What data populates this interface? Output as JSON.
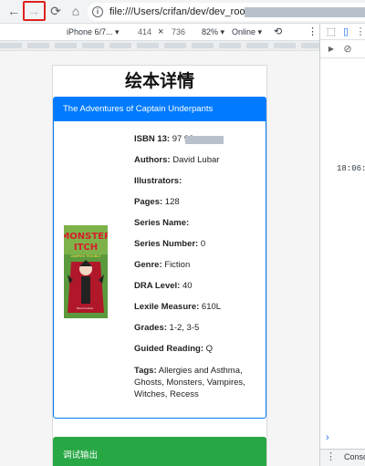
{
  "browser": {
    "back_icon": "←",
    "forward_icon": "→",
    "reload_icon": "⟳",
    "home_icon": "⌂",
    "info_icon": "i",
    "url": "file:///Users/crifan/dev/dev_root/"
  },
  "device_toolbar": {
    "device": "iPhone 6/7...",
    "width": "414",
    "times": "×",
    "height": "736",
    "zoom": "82%",
    "network": "Online",
    "rotate_icon": "⟲",
    "more_icon": "⋮"
  },
  "devtools": {
    "inspect_icon": "⬚",
    "device_icon": "▯",
    "more_icon": "⋮",
    "sidebar_icon": "▶",
    "clear_icon": "⊘",
    "timestamp": "18:06:0",
    "prompt": "›",
    "drawer_more_icon": "⋮",
    "drawer_tab": "Conso"
  },
  "page": {
    "title": "绘本详情",
    "book_title": "The Adventures of Captain Underpants",
    "fields": [
      {
        "label": "ISBN 13:",
        "value": " 97               99"
      },
      {
        "label": "Authors:",
        "value": " David Lubar"
      },
      {
        "label": "Illustrators:",
        "value": ""
      },
      {
        "label": "Pages:",
        "value": " 128"
      },
      {
        "label": "Series Name:",
        "value": ""
      },
      {
        "label": "Series Number:",
        "value": " 0"
      },
      {
        "label": "Genre:",
        "value": " Fiction"
      },
      {
        "label": "DRA Level:",
        "value": " 40"
      },
      {
        "label": "Lexile Measure:",
        "value": " 610L"
      },
      {
        "label": "Grades:",
        "value": " 1-2, 3-5"
      },
      {
        "label": "Guided Reading:",
        "value": " Q"
      },
      {
        "label": "Tags:",
        "value": " Allergies and Asthma, Ghosts, Monsters, Vampires, Witches, Recess"
      }
    ],
    "cover": {
      "title_line1": "MONSTER",
      "title_line2": "ITCH",
      "subtitle": "VAMPIRE TROUBLE",
      "author": "David Lubar"
    },
    "debug_card_title": "调试输出"
  },
  "colors": {
    "primary": "#007bff",
    "success": "#28a745",
    "highlight": "#e02020"
  }
}
